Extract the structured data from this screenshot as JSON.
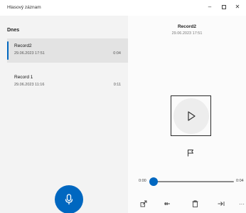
{
  "window": {
    "title": "Hlasový záznam",
    "minimize_glyph": "–",
    "close_glyph": "✕"
  },
  "list": {
    "section_header": "Dnes",
    "recordings": [
      {
        "name": "Record2",
        "date": "29.06.2023 17:51",
        "duration": "0:04",
        "selected": true
      },
      {
        "name": "Record 1",
        "date": "29.06.2023 11:16",
        "duration": "0:11",
        "selected": false
      }
    ]
  },
  "detail": {
    "title": "Record2",
    "date": "29.06.2023 17:51",
    "time_current": "0:00",
    "time_total": "0:04",
    "progress": 0.0
  },
  "toolbar": {
    "more_label": "···"
  },
  "icons": {
    "record": "microphone-icon",
    "play": "play-icon",
    "marker": "flag-icon",
    "share": "share-icon",
    "trim": "trim-icon",
    "delete": "delete-icon",
    "speed": "speed-icon",
    "more": "more-icon"
  },
  "colors": {
    "accent": "#0067c0",
    "list_background": "#f3f3f3",
    "selected_item": "#e3e3e3",
    "detail_background": "#fbfbfb"
  }
}
